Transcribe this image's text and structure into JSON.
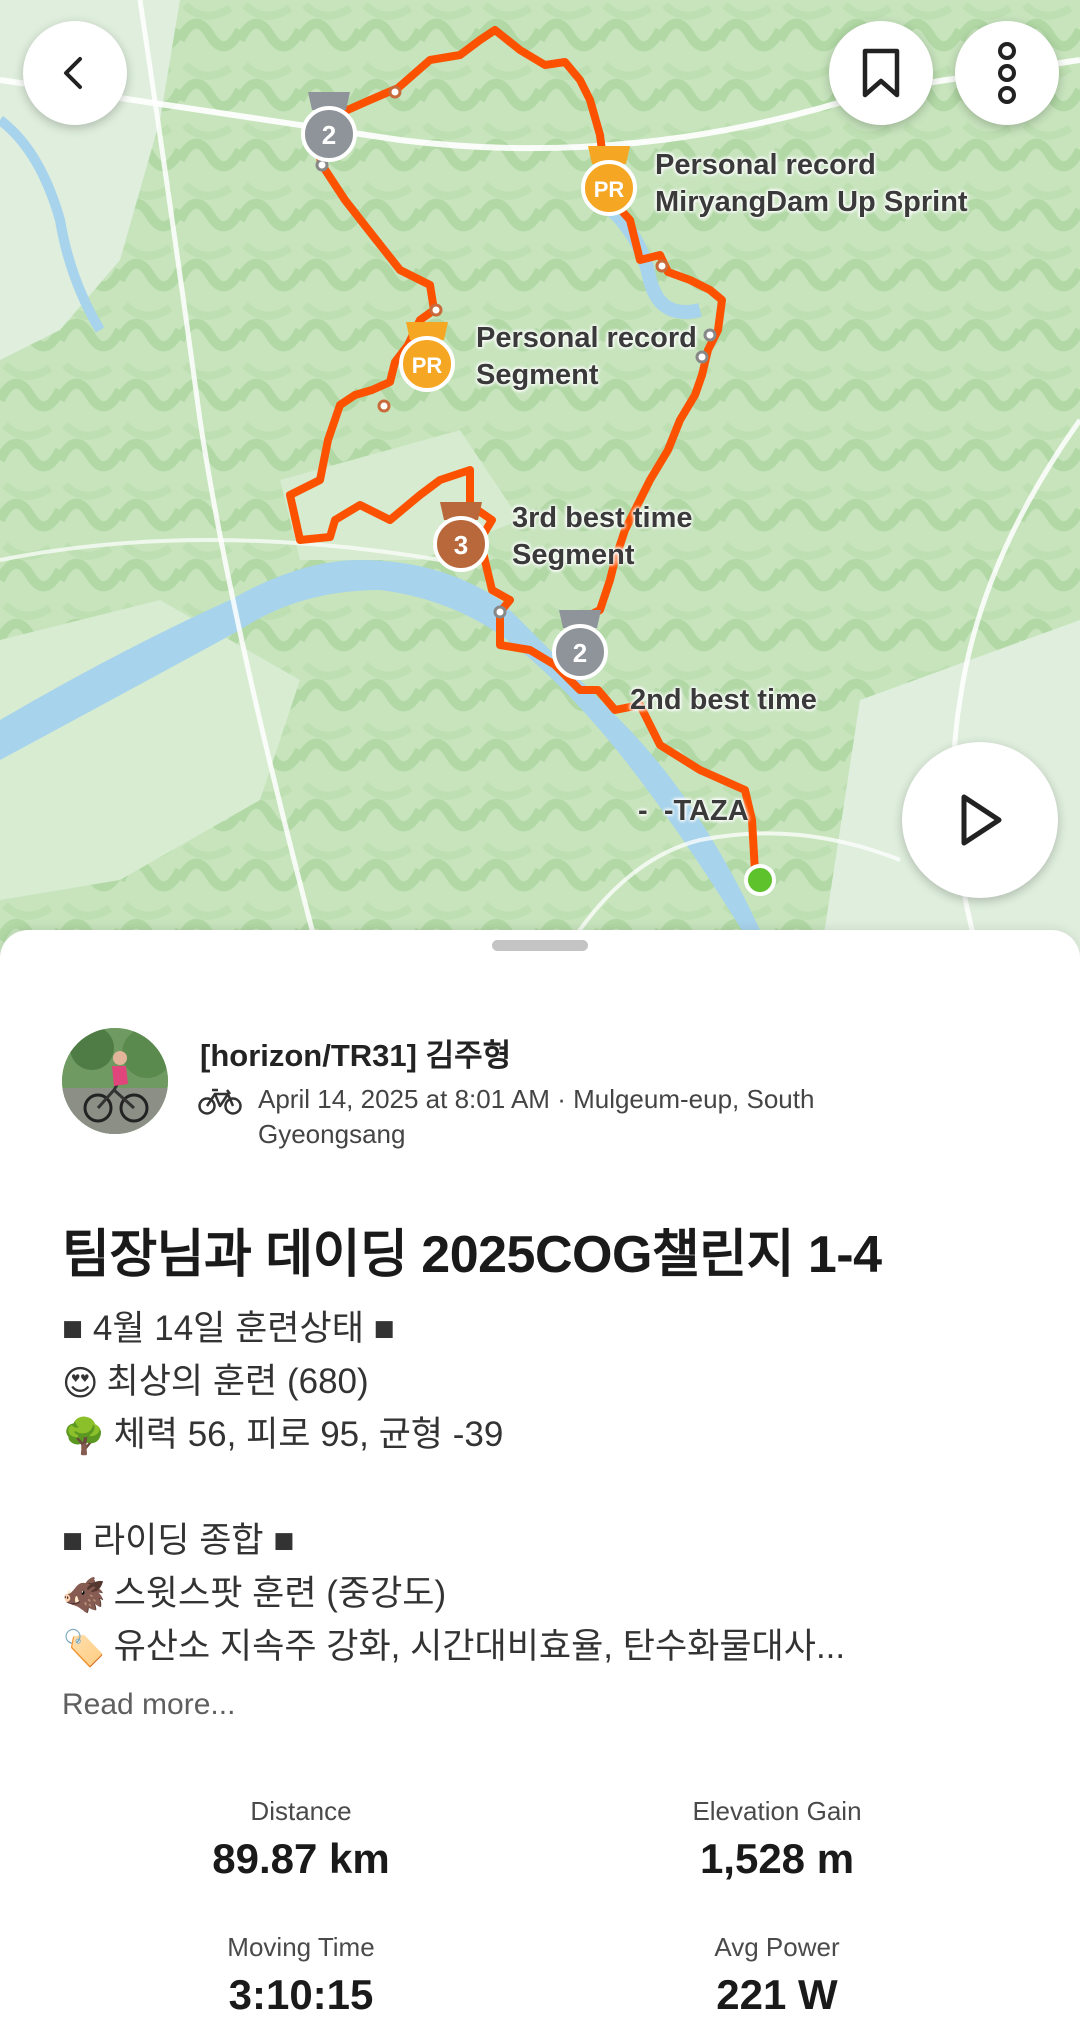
{
  "map": {
    "markers": [
      {
        "title": "Personal record",
        "subtitle": "MiryangDam Up Sprint",
        "badge": "PR"
      },
      {
        "title": "Personal record",
        "subtitle": "Segment",
        "badge": "PR"
      },
      {
        "title": "3rd best time",
        "subtitle": "Segment",
        "badge": "3"
      },
      {
        "title": "2nd best time",
        "subtitle": " -  -TAZA",
        "badge": "2"
      },
      {
        "badge": "2"
      }
    ],
    "colors": {
      "route": "#fc5200",
      "pr_badge": "#f5a623",
      "silver_badge": "#8e9499",
      "bronze_badge": "#b8683a",
      "water": "#a7d3ec",
      "land": "#c7e4bd",
      "start_dot": "#5dc22b"
    }
  },
  "nav": {
    "back_icon": "chevron-left-icon",
    "bookmark_icon": "bookmark-icon",
    "more_icon": "more-vertical-icon",
    "play_icon": "play-icon"
  },
  "athlete": {
    "name": "[horizon/TR31] 김주형",
    "meta": "April 14, 2025 at 8:01 AM · Mulgeum-eup, South Gyeongsang",
    "sport_icon": "bike-icon"
  },
  "activity": {
    "title": "팀장님과 데이딩 2025COG챌린지 1-4",
    "description": [
      {
        "emoji": "",
        "text": "■ 4월 14일 훈련상태 ■"
      },
      {
        "emoji": "😍",
        "text": "최상의 훈련 (680)"
      },
      {
        "emoji": "🌳",
        "text": "체력 56, 피로 95, 균형 -39"
      },
      {
        "emoji": "",
        "text": ""
      },
      {
        "emoji": "",
        "text": "■ 라이딩 종합 ■"
      },
      {
        "emoji": "🐗",
        "text": "스윗스팟 훈련 (중강도)"
      },
      {
        "emoji": "🏷️",
        "text": "유산소 지속주 강화, 시간대비효율, 탄수화물대사..."
      }
    ],
    "read_more": "Read more..."
  },
  "stats": [
    {
      "label": "Distance",
      "value": "89.87 km"
    },
    {
      "label": "Elevation Gain",
      "value": "1,528 m"
    },
    {
      "label": "Moving Time",
      "value": "3:10:15"
    },
    {
      "label": "Avg Power",
      "value": "221 W"
    }
  ]
}
